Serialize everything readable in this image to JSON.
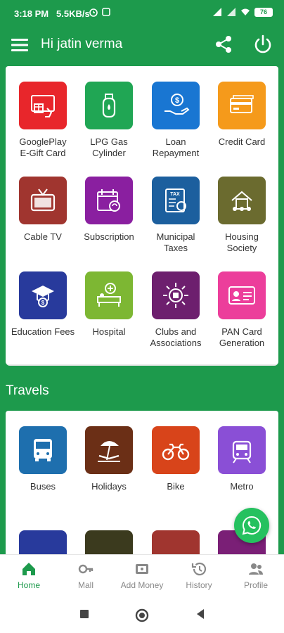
{
  "status_bar": {
    "time": "3:18 PM",
    "speed": "5.5KB/s",
    "battery": "76"
  },
  "app_bar": {
    "greeting": "Hi jatin verma"
  },
  "services": [
    {
      "label": "GooglePlay\nE-Gift Card",
      "color": "#e8262b",
      "icon": "gift-card-icon"
    },
    {
      "label": "LPG Gas\nCylinder",
      "color": "#20a654",
      "icon": "gas-cylinder-icon"
    },
    {
      "label": "Loan\nRepayment",
      "color": "#1976d2",
      "icon": "loan-icon"
    },
    {
      "label": "Credit Card",
      "color": "#f59a1b",
      "icon": "credit-card-icon"
    },
    {
      "label": "Cable TV",
      "color": "#a0352f",
      "icon": "tv-icon"
    },
    {
      "label": "Subscription",
      "color": "#8a1fa0",
      "icon": "calendar-icon"
    },
    {
      "label": "Municipal\nTaxes",
      "color": "#1c5f9e",
      "icon": "tax-icon"
    },
    {
      "label": "Housing\nSociety",
      "color": "#6b6b2f",
      "icon": "house-icon"
    },
    {
      "label": "Education Fees",
      "color": "#283a9c",
      "icon": "education-icon"
    },
    {
      "label": "Hospital",
      "color": "#7db733",
      "icon": "hospital-icon"
    },
    {
      "label": "Clubs and\nAssociations",
      "color": "#6d1f6e",
      "icon": "clubs-icon"
    },
    {
      "label": "PAN Card\nGeneration",
      "color": "#ec3e9b",
      "icon": "id-card-icon"
    }
  ],
  "travels": {
    "title": "Travels",
    "items": [
      {
        "label": "Buses",
        "color": "#1e6fae",
        "icon": "bus-icon"
      },
      {
        "label": "Holidays",
        "color": "#6b2f16",
        "icon": "beach-icon"
      },
      {
        "label": "Bike",
        "color": "#d8441a",
        "icon": "bike-icon"
      },
      {
        "label": "Metro",
        "color": "#8a4fd6",
        "icon": "metro-icon"
      }
    ],
    "partial_colors": [
      "#283a9c",
      "#3b3a1e",
      "#a0352f",
      "#7a1f76"
    ]
  },
  "bottom_nav": [
    {
      "label": "Home",
      "icon": "home-icon",
      "active": true
    },
    {
      "label": "Mall",
      "icon": "key-icon",
      "active": false
    },
    {
      "label": "Add Money",
      "icon": "wallet-icon",
      "active": false
    },
    {
      "label": "History",
      "icon": "history-icon",
      "active": false
    },
    {
      "label": "Profile",
      "icon": "profile-icon",
      "active": false
    }
  ],
  "colors": {
    "primary": "#1d9a4c",
    "whatsapp": "#25c15f"
  }
}
